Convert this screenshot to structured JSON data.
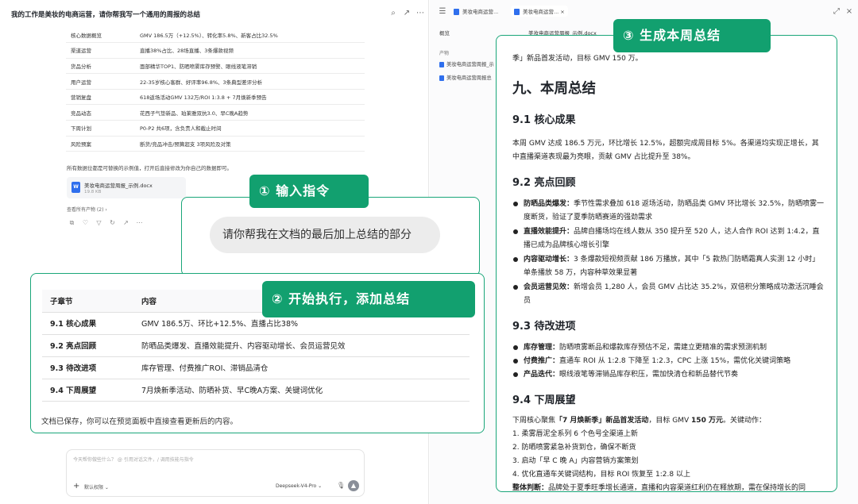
{
  "chat": {
    "title": "我的工作是美妆的电商运营，请你帮我写一个通用的周报的总结",
    "summary_rows": [
      [
        "核心数据概览",
        "GMV 186.5万（+12.5%）、转化率5.8%、新客占比32.5%"
      ],
      [
        "渠道运营",
        "直播38%占比、28场直播、3条爆款视频"
      ],
      [
        "货品分析",
        "面部精华TOP1、防晒喷雾库存预警、眼线液笔滞销"
      ],
      [
        "用户运营",
        "22-35岁核心客群、好评率96.8%、3条典型差评分析"
      ],
      [
        "营销复盘",
        "618返场活动GMV 132万/ROI 1:3.8 + 7月焕新季预告"
      ],
      [
        "竞品动态",
        "花西子气垫新品、珀莱雅双抗3.0、早C晚A趋势"
      ],
      [
        "下周计划",
        "P0-P2 共6项，含负责人和截止时间"
      ],
      [
        "风险预案",
        "断货/竞品冲击/预算超支 3项风险及对策"
      ]
    ],
    "note": "所有数据位都是可替换的示例值，打开后直接修改为你自己的数据即可。",
    "file_name": "美妆电商运营周报_示例.docx",
    "file_size": "19.8 KB",
    "view_all": "查看所有产物 (2) ›",
    "section_table": {
      "headers": [
        "子章节",
        "内容"
      ],
      "rows": [
        [
          "9.1 核心成果",
          "GMV 186.5万、环比+12.5%、直播占比38%"
        ],
        [
          "9.2 亮点回顾",
          "防晒品类爆发、直播效能提升、内容驱动增长、会员运营见效"
        ],
        [
          "9.3 待改进项",
          "库存管理、付费推广ROI、滞销品清仓"
        ],
        [
          "9.4 下周展望",
          "7月焕新季活动、防晒补货、早C晚A方案、关键词优化"
        ]
      ]
    },
    "saved_note": "文档已保存，你可以在预览面板中直接查看更新后的内容。",
    "composer_placeholder": "今天帮你做些什么？ @ 引用对话文件，/ 调用技能与指令",
    "permission": "默认权限 ⌄",
    "model": "Deepseek-V4-Pro ⌄"
  },
  "annotations": {
    "step1": "① 输入指令",
    "step1_bubble": "请你帮我在文档的最后加上总结的部分",
    "step2": "② 开始执行，添加总结",
    "step3": "③ 生成本周总结"
  },
  "preview": {
    "tabs": [
      "美妆电商运营...",
      "美妆电商运营..."
    ],
    "overview": "概览",
    "products_label": "产物",
    "side_files": [
      "美妆电商运营周报_示",
      "美妆电商运营周报总"
    ],
    "doc_title": "美妆电商运营周报_示例.docx",
    "doc": {
      "lead": "季」新品首发活动，目标 GMV 150 万。",
      "h1": "九、本周总结",
      "s1_title": "9.1  核心成果",
      "s1_body": "本周 GMV 达成 186.5 万元，环比增长 12.5%，超额完成周目标 5%。各渠道均实现正增长，其中直播渠道表现最为亮眼，贡献 GMV 占比提升至 38%。",
      "s2_title": "9.2  亮点回顾",
      "s2_items": [
        [
          "防晒品类爆发：",
          "季节性需求叠加 618 返场活动，防晒品类 GMV 环比增长 32.5%，防晒喷雾一度断货，验证了夏季防晒赛道的强劲需求"
        ],
        [
          "直播效能提升：",
          "品牌自播场均在线人数从 350 提升至 520 人，达人合作 ROI 达到 1:4.2，直播已成为品牌核心增长引擎"
        ],
        [
          "内容驱动增长：",
          "3 条爆款短视频贡献 186 万播放，其中「5 款热门防晒霜真人实测 12 小时」单条播放 58 万，内容种草效果显著"
        ],
        [
          "会员运营见效：",
          "新增会员 1,280 人，会员 GMV 占比达 35.2%，双倍积分策略成功激活沉睡会员"
        ]
      ],
      "s3_title": "9.3  待改进项",
      "s3_items": [
        [
          "库存管理：",
          "防晒喷雾断品和爆款库存预估不足，需建立更精准的需求预测机制"
        ],
        [
          "付费推广：",
          "直通车 ROI 从 1:2.8 下降至 1:2.3，CPC 上涨 15%，需优化关键词策略"
        ],
        [
          "产品迭代：",
          "眼线液笔等滞销品库存积压，需加快清仓和新品替代节奏"
        ]
      ],
      "s4_title": "9.4  下周展望",
      "s4_intro_a": "下周核心聚焦",
      "s4_intro_b": "「7 月焕新季」新品首发活动",
      "s4_intro_c": "，目标 GMV ",
      "s4_intro_d": "150 万元",
      "s4_intro_e": "。关键动作：",
      "s4_list": [
        "1.   柔雾唇泥全系列 6 个色号全渠道上新",
        "2.   防晒喷雾紧急补货到仓，确保不断货",
        "3.   启动「早 C 晚 A」内容营销方案策划",
        "4.   优化直通车关键词结构，目标 ROI 恢复至 1:2.8 以上"
      ],
      "judge_label": "整体判断：",
      "judge_body": "品牌处于夏季旺季增长通道，直播和内容渠道红利仍在释放期，需在保持增长的同"
    }
  },
  "colors": {
    "accent": "#12a06f",
    "border": "#1aa679",
    "doc_icon": "#2f6fed"
  }
}
